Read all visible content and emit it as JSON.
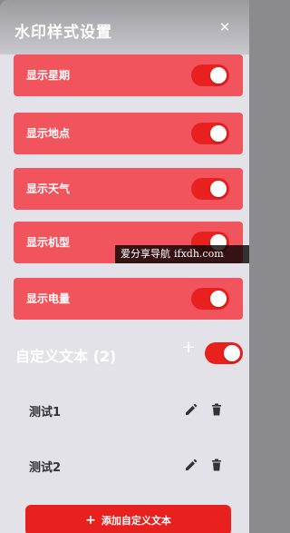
{
  "header": {
    "title": "水印样式设置",
    "close_icon": "close-icon"
  },
  "toggles": [
    {
      "label": "显示星期",
      "enabled": true
    },
    {
      "label": "显示地点",
      "enabled": true
    },
    {
      "label": "显示天气",
      "enabled": true
    },
    {
      "label": "显示机型",
      "enabled": true
    },
    {
      "label": "显示电量",
      "enabled": true
    }
  ],
  "custom": {
    "title": "自定义文本 (2)",
    "enabled": true,
    "items": [
      {
        "label": "测试1"
      },
      {
        "label": "测试2"
      }
    ],
    "add_label": "添加自定义文本"
  },
  "watermark": {
    "site": "爱分享导航",
    "url": "ifxdh.com"
  },
  "colors": {
    "accent": "#e8211e",
    "row_bg": "#f2545d",
    "panel_bg": "#e3e2e8"
  }
}
